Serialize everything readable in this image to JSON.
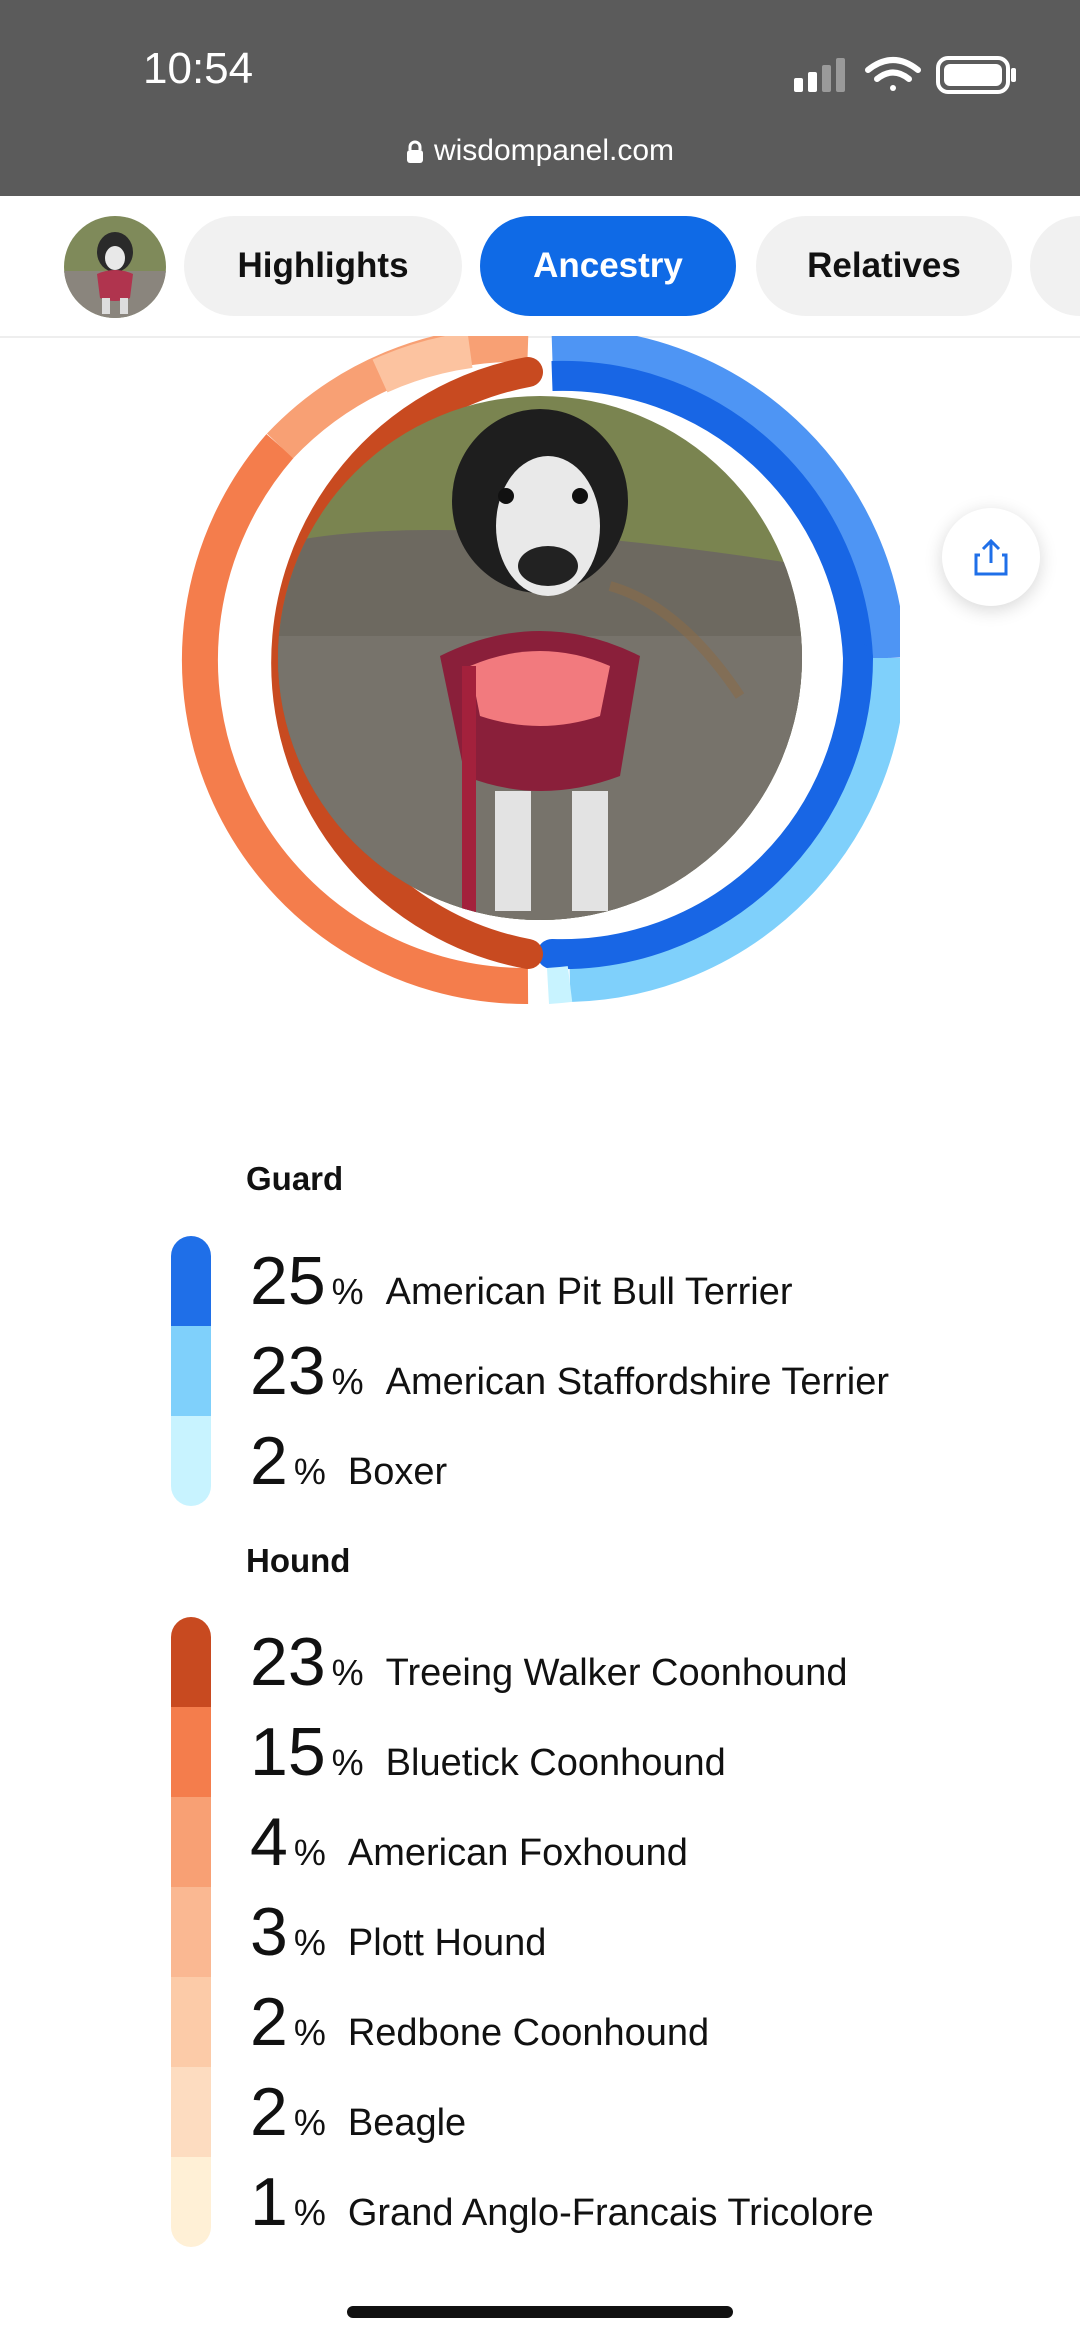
{
  "status_bar": {
    "time": "10:54"
  },
  "browser": {
    "url": "wisdompanel.com"
  },
  "tabs": [
    {
      "label": "Highlights",
      "active": false
    },
    {
      "label": "Ancestry",
      "active": true
    },
    {
      "label": "Relatives",
      "active": false
    }
  ],
  "colors": {
    "accent": "#0f6ae6",
    "guard_blue": "#1f6fe8",
    "hound_orange": "#c84a20"
  },
  "ancestry": {
    "groups": [
      {
        "name": "Guard",
        "breeds": [
          {
            "pct": "25",
            "unit": "%",
            "name": "American Pit Bull Terrier",
            "color": "#1f6fe8"
          },
          {
            "pct": "23",
            "unit": "%",
            "name": "American Staffordshire Terrier",
            "color": "#7fd0fb"
          },
          {
            "pct": "2",
            "unit": "%",
            "name": "Boxer",
            "color": "#c8f3ff"
          }
        ]
      },
      {
        "name": "Hound",
        "breeds": [
          {
            "pct": "23",
            "unit": "%",
            "name": "Treeing Walker Coonhound",
            "color": "#c84a20"
          },
          {
            "pct": "15",
            "unit": "%",
            "name": "Bluetick Coonhound",
            "color": "#f47d4c"
          },
          {
            "pct": "4",
            "unit": "%",
            "name": "American Foxhound",
            "color": "#f8a074"
          },
          {
            "pct": "3",
            "unit": "%",
            "name": "Plott Hound",
            "color": "#fab892"
          },
          {
            "pct": "2",
            "unit": "%",
            "name": "Redbone Coonhound",
            "color": "#fccba8"
          },
          {
            "pct": "2",
            "unit": "%",
            "name": "Beagle",
            "color": "#fddcc0"
          },
          {
            "pct": "1",
            "unit": "%",
            "name": "Grand Anglo-Francais Tricolore",
            "color": "#fff0d6"
          }
        ]
      }
    ]
  }
}
